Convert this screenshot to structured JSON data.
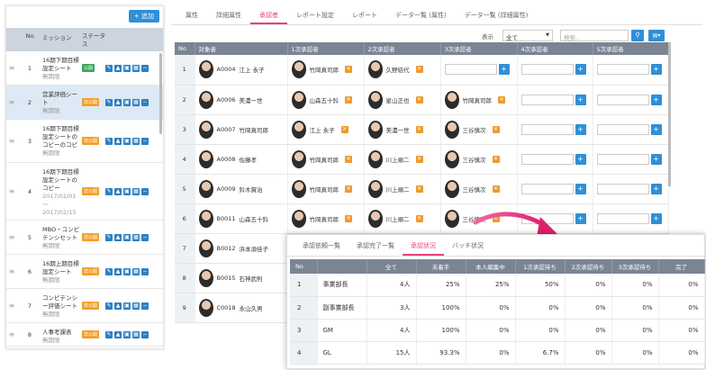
{
  "left": {
    "add_label": "+ 追加",
    "headers": {
      "no": "No.",
      "mission": "ミッション",
      "status": "ステータス"
    },
    "rows": [
      {
        "no": "1",
        "title": "16期下期目標設定シート",
        "sub": "無期限",
        "status": "公開",
        "status_color": "green"
      },
      {
        "no": "2",
        "title": "営業評価シート",
        "sub": "無期限",
        "status": "非公開",
        "status_color": "orange"
      },
      {
        "no": "3",
        "title": "16期下期目標設定シートのコピーのコピ",
        "sub": "無期限",
        "status": "非公開",
        "status_color": "orange"
      },
      {
        "no": "4",
        "title": "16期下期目標設定シートのコピー",
        "sub": "2017/02/01 〜 2017/02/15",
        "status": "非公開",
        "status_color": "orange"
      },
      {
        "no": "5",
        "title": "MBO・コンピテンシセット",
        "sub": "無期限",
        "status": "非公開",
        "status_color": "orange"
      },
      {
        "no": "6",
        "title": "16期上期目標設定シート",
        "sub": "無期限",
        "status": "非公開",
        "status_color": "orange"
      },
      {
        "no": "7",
        "title": "コンピテンシー評価シート",
        "sub": "無期限",
        "status": "非公開",
        "status_color": "orange"
      },
      {
        "no": "8",
        "title": "人事考課表",
        "sub": "無期限",
        "status": "非公開",
        "status_color": "orange"
      }
    ]
  },
  "main": {
    "tabs": [
      "属性",
      "詳細属性",
      "承認者",
      "レポート設定",
      "レポート",
      "データ一覧 (属性)",
      "データ一覧 (詳細属性)"
    ],
    "active_tab": 2,
    "display_label": "表示",
    "display_value": "全て",
    "search_placeholder": "検索...",
    "columns": [
      "No",
      "対象者",
      "1次承認者",
      "2次承認者",
      "3次承認者",
      "4次承認者",
      "5次承認者"
    ],
    "rows": [
      {
        "no": "1",
        "code": "A0004",
        "name": "江上 永子",
        "a1": "竹岡真司郎",
        "a2": "久野結代",
        "a3": ""
      },
      {
        "no": "2",
        "code": "A0006",
        "name": "美濃一世",
        "a1": "山森五十鈴",
        "a2": "星山正也",
        "a3": "竹岡真司郎"
      },
      {
        "no": "3",
        "code": "A0007",
        "name": "竹岡真司郎",
        "a1": "江上 永子",
        "a2": "美濃一世",
        "a3": "三谷慎次"
      },
      {
        "no": "4",
        "code": "A0008",
        "name": "佐藤孝",
        "a1": "竹岡真司郎",
        "a2": "川上順二",
        "a3": "三谷慎次"
      },
      {
        "no": "5",
        "code": "A0009",
        "name": "鈴木賀治",
        "a1": "竹岡真司郎",
        "a2": "川上順二",
        "a3": "三谷慎次"
      },
      {
        "no": "6",
        "code": "B0011",
        "name": "山森五十鈴",
        "a1": "竹岡真司郎",
        "a2": "川上順二",
        "a3": "三谷慎次"
      },
      {
        "no": "7",
        "code": "B0012",
        "name": "浜本須佳子",
        "a1": "",
        "a2": "",
        "a3": ""
      },
      {
        "no": "8",
        "code": "B0015",
        "name": "石神武則",
        "a1": "",
        "a2": "",
        "a3": ""
      },
      {
        "no": "9",
        "code": "C0018",
        "name": "永山久男",
        "a1": "",
        "a2": "",
        "a3": ""
      }
    ]
  },
  "popup": {
    "tabs": [
      "承認依頼一覧",
      "承認完了一覧",
      "承認状況",
      "バッチ状況"
    ],
    "active_tab": 2,
    "columns": [
      "No",
      "",
      "全て",
      "未着手",
      "本人編集中",
      "1次承認待ち",
      "2次承認待ち",
      "3次承認待ち",
      "完了"
    ],
    "rows": [
      {
        "no": "1",
        "name": "事業部長",
        "cells": [
          "4人",
          "25%",
          "25%",
          "50%",
          "0%",
          "0%",
          "0%"
        ]
      },
      {
        "no": "2",
        "name": "副事業部長",
        "cells": [
          "3人",
          "100%",
          "0%",
          "0%",
          "0%",
          "0%",
          "0%"
        ]
      },
      {
        "no": "3",
        "name": "GM",
        "cells": [
          "4人",
          "100%",
          "0%",
          "0%",
          "0%",
          "0%",
          "0%"
        ]
      },
      {
        "no": "4",
        "name": "GL",
        "cells": [
          "15人",
          "93.3%",
          "0%",
          "6.7%",
          "0%",
          "0%",
          "0%"
        ]
      }
    ]
  },
  "colors": {
    "accent": "#e8417e",
    "primary": "#2f8fd8",
    "header": "#7a8594"
  },
  "icons": [
    "edit-icon",
    "lock-icon",
    "copy-icon",
    "export-icon",
    "remove-icon",
    "search-icon",
    "download-icon",
    "close-icon",
    "plus-icon",
    "drag-handle-icon"
  ]
}
